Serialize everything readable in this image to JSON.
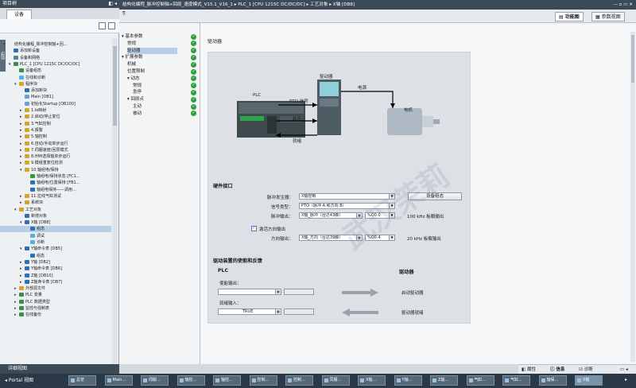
{
  "project_tree": {
    "title": "项目树",
    "tab": "设备",
    "side_strip": "启动",
    "items": [
      "结构化编程_脉冲控制轴+回...",
      "添加新设备",
      "设备和网络",
      "PLC_1 [CPU 1215C DC/DC/DC]",
      "设备组态",
      "在线和诊断",
      "程序块",
      "添加新块",
      "Main [OB1]",
      "初始化Startup [OB100]",
      "1.Io映射",
      "2.启动/停止复位",
      "3.气缸控制",
      "4.报警",
      "5.轴控制",
      "6.自动/手动单步运行",
      "7.伺服速度/回原模式",
      "8.HMI选择轴单步运行",
      "9.模组重复位检测",
      "10.轴组电/保持",
      "轴组电/保持状态 [FC1...",
      "轴组电/位置保持 [FB1...",
      "轴组电保持——调用...",
      "11.拉线气缸测试",
      "系统块",
      "工艺对象",
      "新增对象",
      "X轴 [DB8]",
      "组态",
      "调试",
      "诊断",
      "Y轴命令表 [DB5]",
      "组态",
      "Y轴 [DB2]",
      "Y轴命令表 [DB6]",
      "Z轴 [DB10]",
      "Z轴命令表 [DB7]",
      "外部源文件",
      "PLC 变量",
      "PLC 数据类型",
      "监控与强制表",
      "在线备份"
    ],
    "detail": "详细视图"
  },
  "breadcrumb": "结构化编程_脉冲控制轴+回原_速度模式_V15.1_V16_1 ▸ PLC_1 [CPU 1215C DC/DC/DC] ▸ 工艺对象 ▸ X轴 [DB8]",
  "view_tabs": {
    "functional": "功能图",
    "parameter": "参数视图"
  },
  "nav": {
    "items": [
      "基本参数",
      "常规",
      "驱动器",
      "扩展参数",
      "机械",
      "位置限制",
      "动态",
      "常规",
      "急停",
      "回原点",
      "主动",
      "被动"
    ]
  },
  "section_title": "驱动器",
  "diagram": {
    "plc": "PLC",
    "pto_signal": "PTO 信号",
    "drive": "驱动器",
    "power": "电源",
    "motor": "电机",
    "enable": "启用",
    "ready": "就绪"
  },
  "hw": {
    "title": "硬件接口",
    "pulse_gen_label": "脉冲发生器：",
    "pulse_gen_value": "X轴控制",
    "signal_type_label": "信号类型：",
    "signal_type_value": "PTO（脉冲 A 和方向 B）",
    "pulse_out_label": "脉冲输出：",
    "pulse_out_value": "X轴_脉冲（台达43脚）",
    "pulse_addr": "%Q0.0",
    "pulse_note": "100 kHz 板载输出",
    "dir_check_label": "激活方向输出",
    "dir_out_label": "方向输出：",
    "dir_out_value": "X轴_方向（台达39脚）",
    "dir_addr": "%Q0.4",
    "dir_note": "20 kHz 板载输出",
    "device_config_btn": "设备组态"
  },
  "enable": {
    "title": "驱动装置的使能和反馈",
    "plc": "PLC",
    "drive": "驱动器",
    "enable_out_label": "使能输出：",
    "enable_out_value": "",
    "enable_drive": "启动驱动器",
    "ready_in_label": "就绪输入：",
    "ready_in_value": "TRUE",
    "drive_ready": "驱动器就绪"
  },
  "info_bar": {
    "properties": "属性",
    "info": "信息",
    "diagnostics": "诊断"
  },
  "taskbar": {
    "portal": "Portal 视图",
    "items": [
      "总览",
      "Main...",
      "伺服...",
      "轴控...",
      "轴控...",
      "控制...",
      "控制...",
      "同服...",
      "X轴...",
      "Y轴...",
      "Z轴...",
      "气缸...",
      "气缸...",
      "轴保...",
      "X轴"
    ]
  },
  "watermark": "武汉茉莉"
}
